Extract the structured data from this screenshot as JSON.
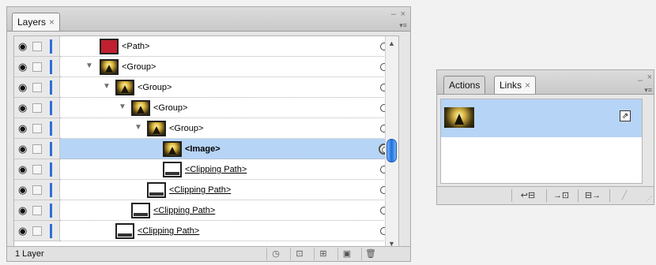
{
  "layers_panel": {
    "tab_label": "Layers",
    "status_text": "1 Layer",
    "rows": [
      {
        "label": "<Path>"
      },
      {
        "label": "<Group>"
      },
      {
        "label": "<Group>"
      },
      {
        "label": "<Group>"
      },
      {
        "label": "<Group>"
      },
      {
        "label": "<Image>"
      },
      {
        "label": "<Clipping Path>"
      },
      {
        "label": "<Clipping Path>"
      },
      {
        "label": "<Clipping Path>"
      },
      {
        "label": "<Clipping Path>"
      }
    ],
    "close_symbol": "×",
    "minimize_symbol": "–"
  },
  "links_panel": {
    "tabs": [
      {
        "label": "Actions"
      },
      {
        "label": "Links"
      }
    ],
    "close_symbol": "×"
  },
  "colors": {
    "selection": "#b6d4f6",
    "layer_color": "#2f6fd8",
    "path_thumbnail": "#c02030"
  },
  "icons": {
    "visibility": "eye-icon",
    "lock": "lock-toggle",
    "expand": "triangle-down-icon",
    "target": "target-circle-icon",
    "footer": [
      "locate-object-icon",
      "make-clipping-mask-icon",
      "new-sublayer-icon",
      "new-layer-icon",
      "trash-icon"
    ],
    "links_footer": [
      "relink-icon",
      "go-to-link-icon",
      "update-link-icon",
      "edit-original-icon"
    ]
  }
}
